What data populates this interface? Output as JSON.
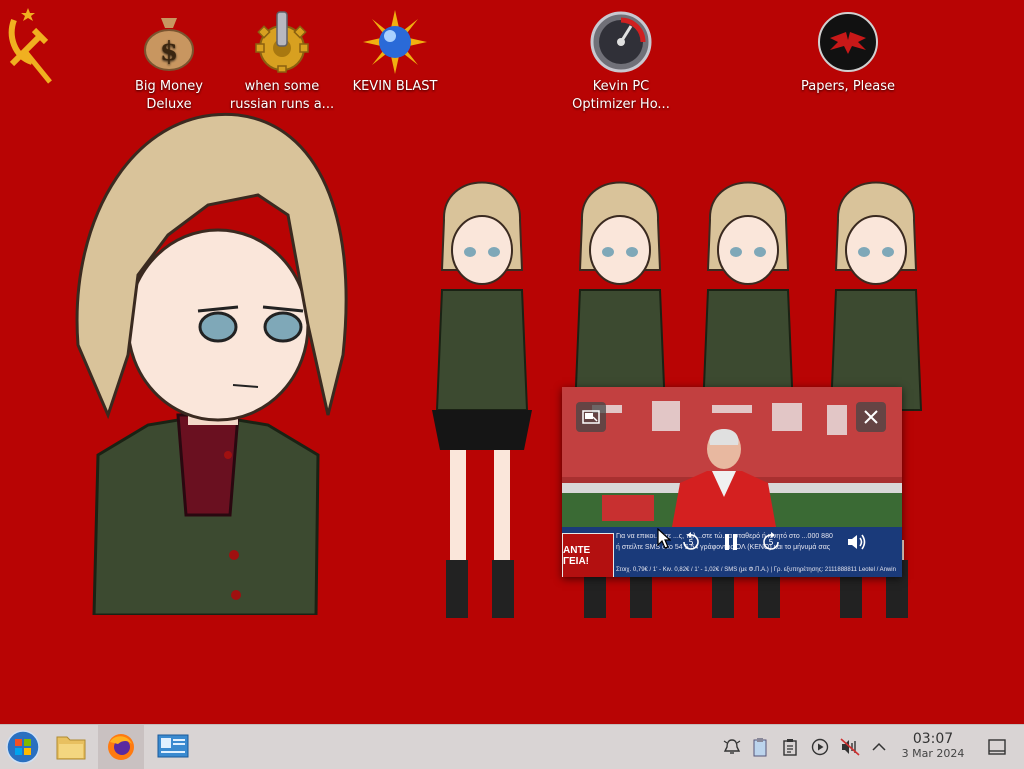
{
  "desktop": {
    "background_color": "#b80404",
    "icons": [
      {
        "label": "Big Money Deluxe",
        "icon": "money-bag-icon"
      },
      {
        "label": "when some russian runs a...",
        "icon": "gear-icon"
      },
      {
        "label": "KEVIN BLAST",
        "icon": "sun-orb-icon"
      },
      {
        "label": "Kevin PC Optimizer Ho...",
        "icon": "speedometer-icon"
      },
      {
        "label": "Papers, Please",
        "icon": "eagle-emblem-icon"
      }
    ]
  },
  "pip": {
    "banner_label": "ΑΝΤΕ ΓΕΙΑ!",
    "banner_line1": "Για να επικοι...στε ...ς, τηλ...στε τώ...α σταθερό ή κινητό στο ...000 880",
    "banner_line2": "ή στείλτε SMS στο 54 5 54 γράφοντας ΟΛ (ΚΕΝΟ) και το μήνυμά σας",
    "banner_bottom": "Στοιχ. 0,79€ / 1' - Κιν. 0,82€ / 1' - 1,02€ / SMS (με Φ.Π.Α.) | Γρ. εξυπηρέτησης: 2111888811 Leotel / Anwin",
    "rewind_label": "5",
    "forward_label": "5",
    "buttons": {
      "exit_pip": "exit-pip-icon",
      "close": "close-icon",
      "rewind": "rewind-5-icon",
      "pause": "pause-icon",
      "forward": "forward-5-icon",
      "volume": "volume-icon"
    }
  },
  "taskbar": {
    "items": [
      "start-orb-icon",
      "file-manager-icon",
      "firefox-icon",
      "system-settings-icon"
    ],
    "tray": [
      "notifications-icon",
      "clipboard-icon",
      "klipper-icon",
      "media-player-icon",
      "volume-muted-icon",
      "expand-tray-icon"
    ],
    "clock_time": "03:07",
    "clock_date": "3 Mar 2024",
    "show_desktop": "show-desktop-icon"
  }
}
